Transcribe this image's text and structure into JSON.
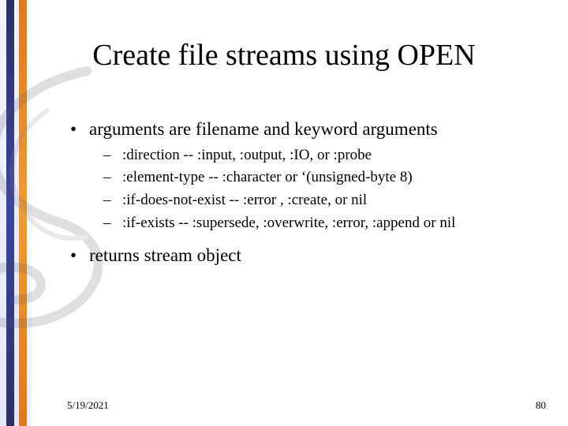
{
  "title": "Create file streams using OPEN",
  "bullets": [
    {
      "level": 1,
      "text": "arguments are filename and keyword arguments"
    },
    {
      "level": 2,
      "text": ":direction -- :input, :output, :IO, or :probe"
    },
    {
      "level": 2,
      "text": ":element-type -- :character or ‘(unsigned-byte 8)"
    },
    {
      "level": 2,
      "text": ":if-does-not-exist -- :error , :create, or nil"
    },
    {
      "level": 2,
      "text": ":if-exists -- :supersede, :overwrite, :error,  :append or nil"
    },
    {
      "level": 1,
      "text": "returns stream object"
    }
  ],
  "footer": {
    "date": "5/19/2021",
    "page": "80"
  }
}
